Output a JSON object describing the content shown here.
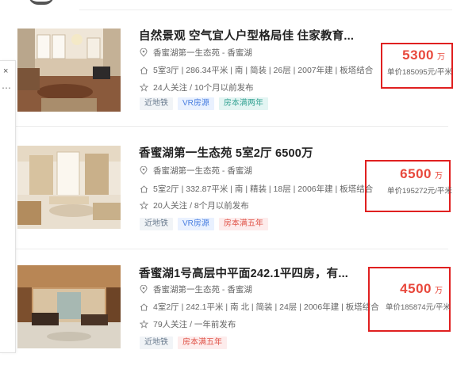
{
  "listings": [
    {
      "title": "自然景观 空气宜人户型格局佳 住家教育...",
      "location": "香蜜湖第一生态苑 - 香蜜湖",
      "info": "5室3厅 | 286.34平米 | 南 | 简装 | 26层 | 2007年建 | 板塔结合",
      "follow": "24人关注 / 10个月以前发布",
      "tags": [
        {
          "label": "近地铁",
          "style": "grey"
        },
        {
          "label": "VR房源",
          "style": "blue"
        },
        {
          "label": "房本满两年",
          "style": "teal"
        }
      ],
      "total_price": "5300",
      "total_unit": "万",
      "unit_price": "单价185095元/平米"
    },
    {
      "title": "香蜜湖第一生态苑 5室2厅 6500万",
      "location": "香蜜湖第一生态苑 - 香蜜湖",
      "info": "5室2厅 | 332.87平米 | 南 | 精装 | 18层 | 2006年建 | 板塔结合",
      "follow": "20人关注 / 8个月以前发布",
      "tags": [
        {
          "label": "近地铁",
          "style": "grey"
        },
        {
          "label": "VR房源",
          "style": "blue"
        },
        {
          "label": "房本满五年",
          "style": "red"
        }
      ],
      "total_price": "6500",
      "total_unit": "万",
      "unit_price": "单价195272元/平米"
    },
    {
      "title": "香蜜湖1号高层中平面242.1平四房，有...",
      "location": "香蜜湖第一生态苑 - 香蜜湖",
      "info": "4室2厅 | 242.1平米 | 南 北 | 简装 | 24层 | 2006年建 | 板塔结合",
      "follow": "79人关注 / 一年前发布",
      "tags": [
        {
          "label": "近地铁",
          "style": "grey"
        },
        {
          "label": "房本满五年",
          "style": "red"
        }
      ],
      "total_price": "4500",
      "total_unit": "万",
      "unit_price": "单价185874元/平米"
    }
  ],
  "side_panel": {
    "close_glyph": "×",
    "more_glyph": "⋯"
  },
  "colors": {
    "price": "#e8483c",
    "highlight_box": "#e02020"
  },
  "icons": [
    "location-pin-icon",
    "house-icon",
    "star-icon",
    "close-icon",
    "more-icon"
  ]
}
